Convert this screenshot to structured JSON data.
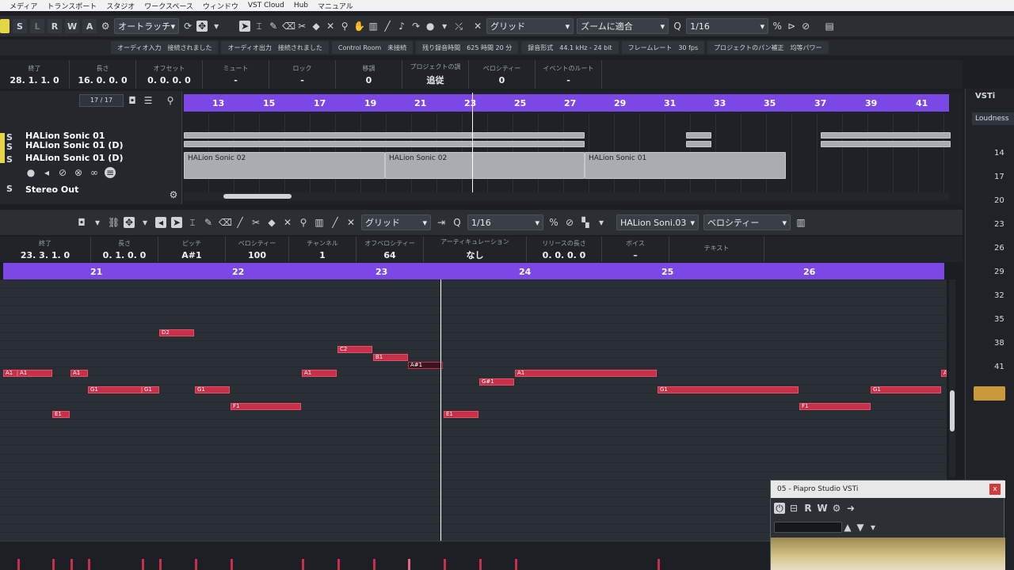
{
  "menu": [
    "メディア",
    "トランスポート",
    "スタジオ",
    "ワークスペース",
    "ウィンドウ",
    "VST Cloud",
    "Hub",
    "マニュアル"
  ],
  "toolbar": {
    "buttons": [
      "S",
      "L",
      "R",
      "W",
      "A"
    ],
    "automation": "オートラッチ",
    "snap": "グリッド",
    "zoom": "ズームに適合",
    "quantize": "1/16"
  },
  "status": [
    {
      "label": "オーディオ入力",
      "value": "接続されました"
    },
    {
      "label": "オーディオ出力",
      "value": "接続されました"
    },
    {
      "label": "Control Room",
      "value": "未接続"
    },
    {
      "label": "残り録音時間",
      "value": "625 時間 20 分"
    },
    {
      "label": "録音形式",
      "value": "44.1 kHz - 24 bit"
    },
    {
      "label": "フレームレート",
      "value": "30 fps"
    },
    {
      "label": "プロジェクトのパン補正",
      "value": "均等パワー"
    }
  ],
  "info": [
    {
      "label": "終了",
      "value": "28. 1. 1. 0"
    },
    {
      "label": "長さ",
      "value": "16. 0. 0. 0"
    },
    {
      "label": "オフセット",
      "value": "0. 0. 0. 0"
    },
    {
      "label": "ミュート",
      "value": "-"
    },
    {
      "label": "ロック",
      "value": "-"
    },
    {
      "label": "移調",
      "value": "0"
    },
    {
      "label": "プロジェクトの調",
      "value": "追従"
    },
    {
      "label": "ベロシティー",
      "value": "0"
    },
    {
      "label": "イベントのルート",
      "value": "-"
    }
  ],
  "tracks": {
    "count": "17 / 17",
    "items": [
      "HALion Sonic 01",
      "HALion Sonic 01 (D)",
      "HALion Sonic 01 (D)",
      "Stereo Out"
    ]
  },
  "arrange": {
    "bars": [
      "13",
      "15",
      "17",
      "19",
      "21",
      "23",
      "25",
      "27",
      "29",
      "31",
      "33",
      "35",
      "37",
      "39",
      "41"
    ],
    "parts": [
      "HALion Sonic 02",
      "HALion Sonic 02",
      "HALion Sonic 01"
    ]
  },
  "editor": {
    "snap": "グリッド",
    "quantize": "1/16",
    "instrument": "HALion Soni.03",
    "lane": "ベロシティー",
    "info": [
      {
        "label": "終了",
        "value": "23. 3. 1. 0"
      },
      {
        "label": "長さ",
        "value": "0. 1. 0. 0"
      },
      {
        "label": "ピッチ",
        "value": "A#1"
      },
      {
        "label": "ベロシティー",
        "value": "100"
      },
      {
        "label": "チャンネル",
        "value": "1"
      },
      {
        "label": "オフベロシティー",
        "value": "64"
      },
      {
        "label": "アーティキュレーション",
        "value": "なし"
      },
      {
        "label": "リリースの長さ",
        "value": "0. 0. 0. 0"
      },
      {
        "label": "ボイス",
        "value": "–"
      },
      {
        "label": "テキスト",
        "value": ""
      }
    ],
    "bars": [
      "21",
      "22",
      "23",
      "24",
      "25",
      "26"
    ],
    "notes": [
      "A1",
      "A1",
      "A1",
      "D2",
      "G1",
      "G1",
      "E1",
      "G1",
      "F1",
      "A1",
      "C2",
      "B1",
      "A#1",
      "E1",
      "G#1",
      "A1",
      "G1",
      "F1",
      "G1",
      "A"
    ]
  },
  "rightpanel": {
    "tab": "VSTi",
    "item": "Loudness",
    "scale": [
      "14",
      "17",
      "20",
      "23",
      "26",
      "29",
      "32",
      "35",
      "38",
      "41"
    ]
  },
  "vsti": {
    "title": "05 - Piapro Studio VSTi",
    "btns": [
      "R",
      "W"
    ]
  }
}
